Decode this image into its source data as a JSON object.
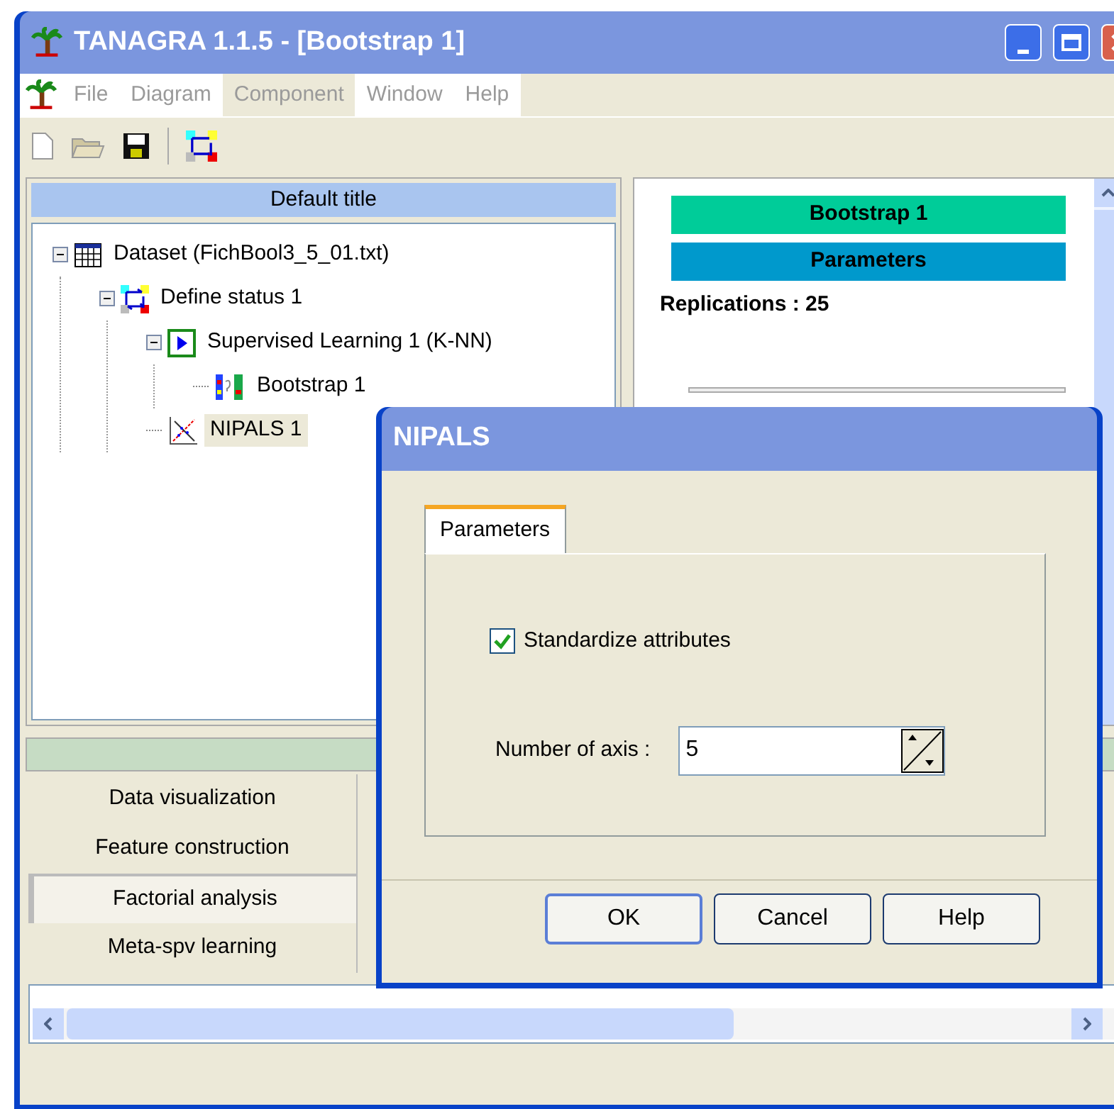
{
  "window": {
    "title": "TANAGRA 1.1.5 - [Bootstrap 1]"
  },
  "menu": [
    {
      "label": "File",
      "highlighted": false
    },
    {
      "label": "Diagram",
      "highlighted": false
    },
    {
      "label": "Component",
      "highlighted": true
    },
    {
      "label": "Window",
      "highlighted": false
    },
    {
      "label": "Help",
      "highlighted": false
    }
  ],
  "diagram": {
    "title": "Default title",
    "tree": [
      {
        "label": "Dataset (FichBool3_5_01.txt)",
        "kind": "dataset",
        "expanded": true,
        "selected": false,
        "children": [
          {
            "label": "Define status 1",
            "kind": "status",
            "expanded": true,
            "selected": false,
            "children": [
              {
                "label": "Supervised Learning 1 (K-NN)",
                "kind": "learning",
                "expanded": true,
                "selected": false,
                "children": [
                  {
                    "label": "Bootstrap 1",
                    "kind": "bootstrap",
                    "selected": false
                  }
                ]
              },
              {
                "label": "NIPALS 1",
                "kind": "nipals",
                "selected": true
              }
            ]
          }
        ]
      }
    ]
  },
  "report": {
    "heading": "Bootstrap 1",
    "section": "Parameters",
    "line": "Replications : 25"
  },
  "palette": {
    "categories": [
      {
        "label": "Data visualization",
        "selected": false
      },
      {
        "label": "Feature construction",
        "selected": false
      },
      {
        "label": "Factorial analysis",
        "selected": true
      },
      {
        "label": "Meta-spv learning",
        "selected": false
      }
    ]
  },
  "dialog": {
    "title": "NIPALS",
    "tab": "Parameters",
    "checkbox": {
      "label": "Standardize attributes",
      "checked": true
    },
    "field": {
      "label": "Number of axis :",
      "value": "5"
    },
    "buttons": [
      "OK",
      "Cancel",
      "Help"
    ]
  }
}
